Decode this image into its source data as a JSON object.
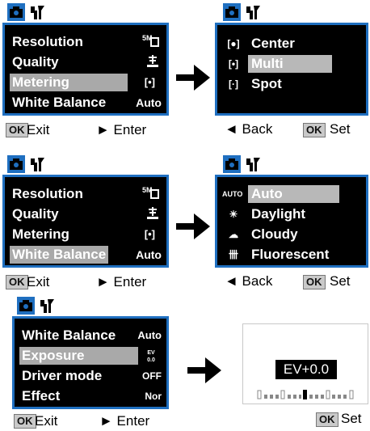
{
  "colors": {
    "border": "#1f6fc0",
    "highlight": "#a9a9a9",
    "screen_bg": "#000000",
    "tab_bg": "#1f6fc0"
  },
  "panel1": {
    "items": [
      {
        "label": "Resolution",
        "value": "5M"
      },
      {
        "label": "Quality",
        "value": ""
      },
      {
        "label": "Metering",
        "value": "[•]"
      },
      {
        "label": "White Balance",
        "value": "Auto"
      }
    ],
    "selected": "Metering",
    "footer": {
      "ok": "OK",
      "left": "Exit",
      "right": "► Enter"
    }
  },
  "panel2": {
    "items": [
      {
        "icon": "[●]",
        "label": "Center"
      },
      {
        "icon": "[•]",
        "label": "Multi"
      },
      {
        "icon": "[·]",
        "label": "Spot"
      }
    ],
    "selected": "Multi",
    "footer": {
      "left": "◄ Back",
      "ok": "OK",
      "right": "Set"
    }
  },
  "panel3": {
    "items": [
      {
        "label": "Resolution",
        "value": "5M"
      },
      {
        "label": "Quality",
        "value": ""
      },
      {
        "label": "Metering",
        "value": "[•]"
      },
      {
        "label": "White Balance",
        "value": "Auto"
      }
    ],
    "selected": "White Balance",
    "footer": {
      "ok": "OK",
      "left": "Exit",
      "right": "► Enter"
    }
  },
  "panel4": {
    "items": [
      {
        "icon": "AUTO",
        "label": "Auto"
      },
      {
        "icon": "☀",
        "label": "Daylight"
      },
      {
        "icon": "☁",
        "label": "Cloudy"
      },
      {
        "icon": "卌",
        "label": "Fluorescent"
      }
    ],
    "selected": "Auto",
    "footer": {
      "left": "◄ Back",
      "ok": "OK",
      "right": "Set"
    }
  },
  "panel5": {
    "items": [
      {
        "label": "White Balance",
        "value": "Auto"
      },
      {
        "label": "Exposure",
        "value": "EV 0.0"
      },
      {
        "label": "Driver mode",
        "value": "OFF"
      },
      {
        "label": "Effect",
        "value": "Nor"
      }
    ],
    "selected": "Exposure",
    "footer": {
      "ok": "OK",
      "left": "Exit",
      "right": "► Enter"
    }
  },
  "panel6": {
    "ev_value": "EV+0.0",
    "footer": {
      "ok": "OK",
      "right": "Set"
    }
  }
}
